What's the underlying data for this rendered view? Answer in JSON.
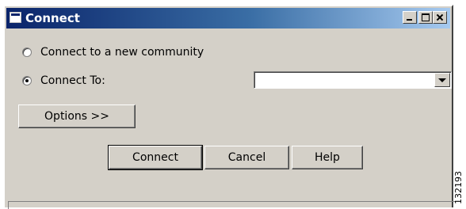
{
  "window": {
    "title": "Connect"
  },
  "options": {
    "new_community_label": "Connect to a new community",
    "new_community_checked": false,
    "connect_to_label": "Connect To:",
    "connect_to_checked": true,
    "connect_to_value": ""
  },
  "buttons": {
    "options_label": "Options >>",
    "connect_label": "Connect",
    "cancel_label": "Cancel",
    "help_label": "Help"
  },
  "figure_id": "132193",
  "colors": {
    "face": "#d4d0c8",
    "title_start": "#0a246a",
    "title_end": "#a6caf0"
  }
}
